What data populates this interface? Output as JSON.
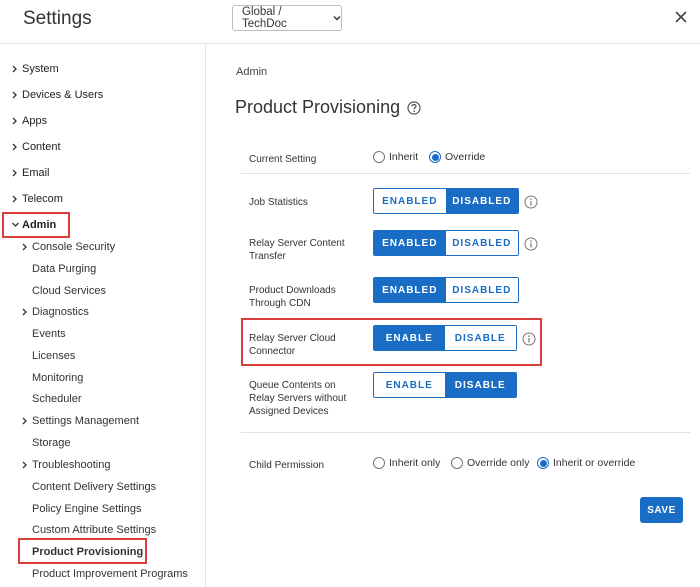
{
  "header": {
    "title": "Settings",
    "scope_select": "Global / TechDoc"
  },
  "sidebar": {
    "top_items": [
      {
        "label": "System"
      },
      {
        "label": "Devices & Users"
      },
      {
        "label": "Apps"
      },
      {
        "label": "Content"
      },
      {
        "label": "Email"
      },
      {
        "label": "Telecom"
      },
      {
        "label": "Admin"
      }
    ],
    "admin_children": [
      {
        "label": "Console Security",
        "expandable": true
      },
      {
        "label": "Data Purging",
        "expandable": false
      },
      {
        "label": "Cloud Services",
        "expandable": false
      },
      {
        "label": "Diagnostics",
        "expandable": true
      },
      {
        "label": "Events",
        "expandable": false
      },
      {
        "label": "Licenses",
        "expandable": false
      },
      {
        "label": "Monitoring",
        "expandable": false
      },
      {
        "label": "Scheduler",
        "expandable": false
      },
      {
        "label": "Settings Management",
        "expandable": true
      },
      {
        "label": "Storage",
        "expandable": false
      },
      {
        "label": "Troubleshooting",
        "expandable": true
      },
      {
        "label": "Content Delivery Settings",
        "expandable": false
      },
      {
        "label": "Policy Engine Settings",
        "expandable": false
      },
      {
        "label": "Custom Attribute Settings",
        "expandable": false
      },
      {
        "label": "Product Provisioning",
        "expandable": false,
        "selected": true
      },
      {
        "label": "Product Improvement Programs",
        "expandable": false
      }
    ]
  },
  "main": {
    "breadcrumb": "Admin",
    "title": "Product Provisioning",
    "current_setting": {
      "label": "Current Setting",
      "options": [
        "Inherit",
        "Override"
      ],
      "selected": "Override"
    },
    "settings": [
      {
        "label": "Job Statistics",
        "on_label": "ENABLED",
        "off_label": "DISABLED",
        "value": "DISABLED",
        "has_info": true
      },
      {
        "label": "Relay Server Content Transfer",
        "on_label": "ENABLED",
        "off_label": "DISABLED",
        "value": "ENABLED",
        "has_info": true
      },
      {
        "label": "Product Downloads Through CDN",
        "on_label": "ENABLED",
        "off_label": "DISABLED",
        "value": "ENABLED",
        "has_info": false
      },
      {
        "label": "Relay Server Cloud Connector",
        "on_label": "ENABLE",
        "off_label": "DISABLE",
        "value": "ENABLE",
        "has_info": true
      },
      {
        "label": "Queue Contents on Relay Servers without Assigned Devices",
        "on_label": "ENABLE",
        "off_label": "DISABLE",
        "value": "DISABLE",
        "has_info": false
      }
    ],
    "child_permission": {
      "label": "Child Permission",
      "options": [
        "Inherit only",
        "Override only",
        "Inherit or override"
      ],
      "selected": "Inherit or override"
    },
    "save_label": "SAVE"
  },
  "colors": {
    "accent": "#1a6dc5",
    "highlight": "#d93a3a"
  }
}
